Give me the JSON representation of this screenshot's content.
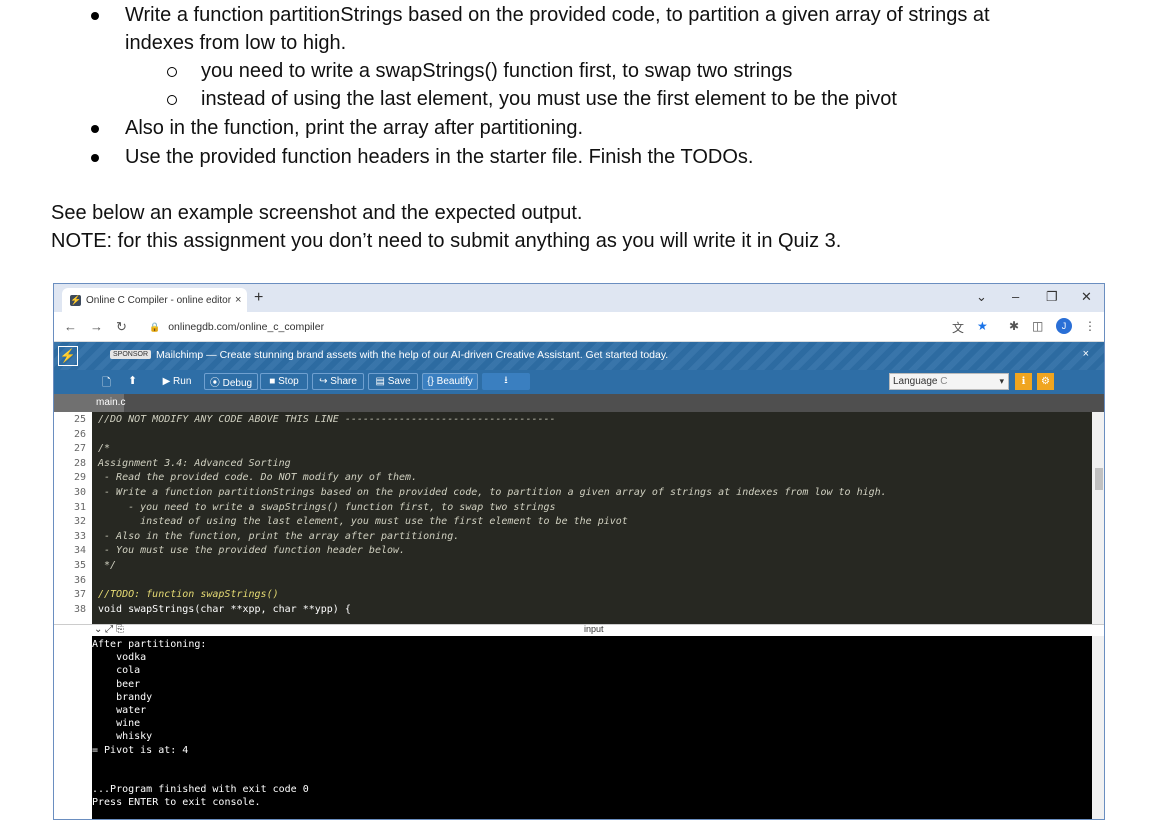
{
  "document": {
    "bullets": [
      "Write a function partitionStrings based on the provided code, to partition a given array of strings at",
      "indexes from low to high.",
      "you need to write a swapStrings() function first, to swap two strings",
      "instead of using the last element, you must use the first element to be the pivot",
      "Also in the function, print the array after partitioning.",
      "Use the provided function headers in the starter file. Finish the TODOs."
    ],
    "para1": "See below an example screenshot and the expected output.",
    "para2": "NOTE: for this assignment you don’t need to submit anything as you will write it in Quiz 3."
  },
  "browser": {
    "tab_title": "Online C Compiler - online editor",
    "tab_close": "×",
    "new_tab": "+",
    "url": "onlinegdb.com/online_c_compiler",
    "avatar": "J"
  },
  "sponsor": {
    "badge": "SPONSOR",
    "text": "Mailchimp — Create stunning brand assets with the help of our AI-driven Creative Assistant. Get started today.",
    "close": "×"
  },
  "toolbar": {
    "run": "▶ Run",
    "debug": "⦿ Debug",
    "stop": "■ Stop",
    "share": "↪ Share",
    "save": "▤ Save",
    "beautify": "{} Beautify",
    "download": "⭳",
    "language_label": "Language",
    "language_value": "C"
  },
  "file_tab": "main.c",
  "editor_lines": [
    {
      "n": "25",
      "t": "//DO NOT MODIFY ANY CODE ABOVE THIS LINE -----------------------------------",
      "k": "c"
    },
    {
      "n": "26",
      "t": "",
      "k": "c"
    },
    {
      "n": "27",
      "t": "/*",
      "k": "c"
    },
    {
      "n": "28",
      "t": "Assignment 3.4: Advanced Sorting",
      "k": "c"
    },
    {
      "n": "29",
      "t": " - Read the provided code. Do NOT modify any of them.",
      "k": "c"
    },
    {
      "n": "30",
      "t": " - Write a function partitionStrings based on the provided code, to partition a given array of strings at indexes from low to high.",
      "k": "c"
    },
    {
      "n": "31",
      "t": "     - you need to write a swapStrings() function first, to swap two strings",
      "k": "c"
    },
    {
      "n": "32",
      "t": "       instead of using the last element, you must use the first element to be the pivot",
      "k": "c"
    },
    {
      "n": "33",
      "t": " - Also in the function, print the array after partitioning.",
      "k": "c"
    },
    {
      "n": "34",
      "t": " - You must use the provided function header below.",
      "k": "c"
    },
    {
      "n": "35",
      "t": " */",
      "k": "c"
    },
    {
      "n": "36",
      "t": "",
      "k": "c"
    },
    {
      "n": "37",
      "t": "//TODO: function swapStrings()",
      "k": "t"
    },
    {
      "n": "38",
      "t": "void swapStrings(char **xpp, char **ypp) {",
      "k": "k"
    }
  ],
  "io_label": "input",
  "console_lines": [
    "After partitioning:",
    "    vodka",
    "    cola",
    "    beer",
    "    brandy",
    "    water",
    "    wine",
    "    whisky",
    "= Pivot is at: 4",
    "",
    "",
    "...Program finished with exit code 0",
    "Press ENTER to exit console."
  ]
}
